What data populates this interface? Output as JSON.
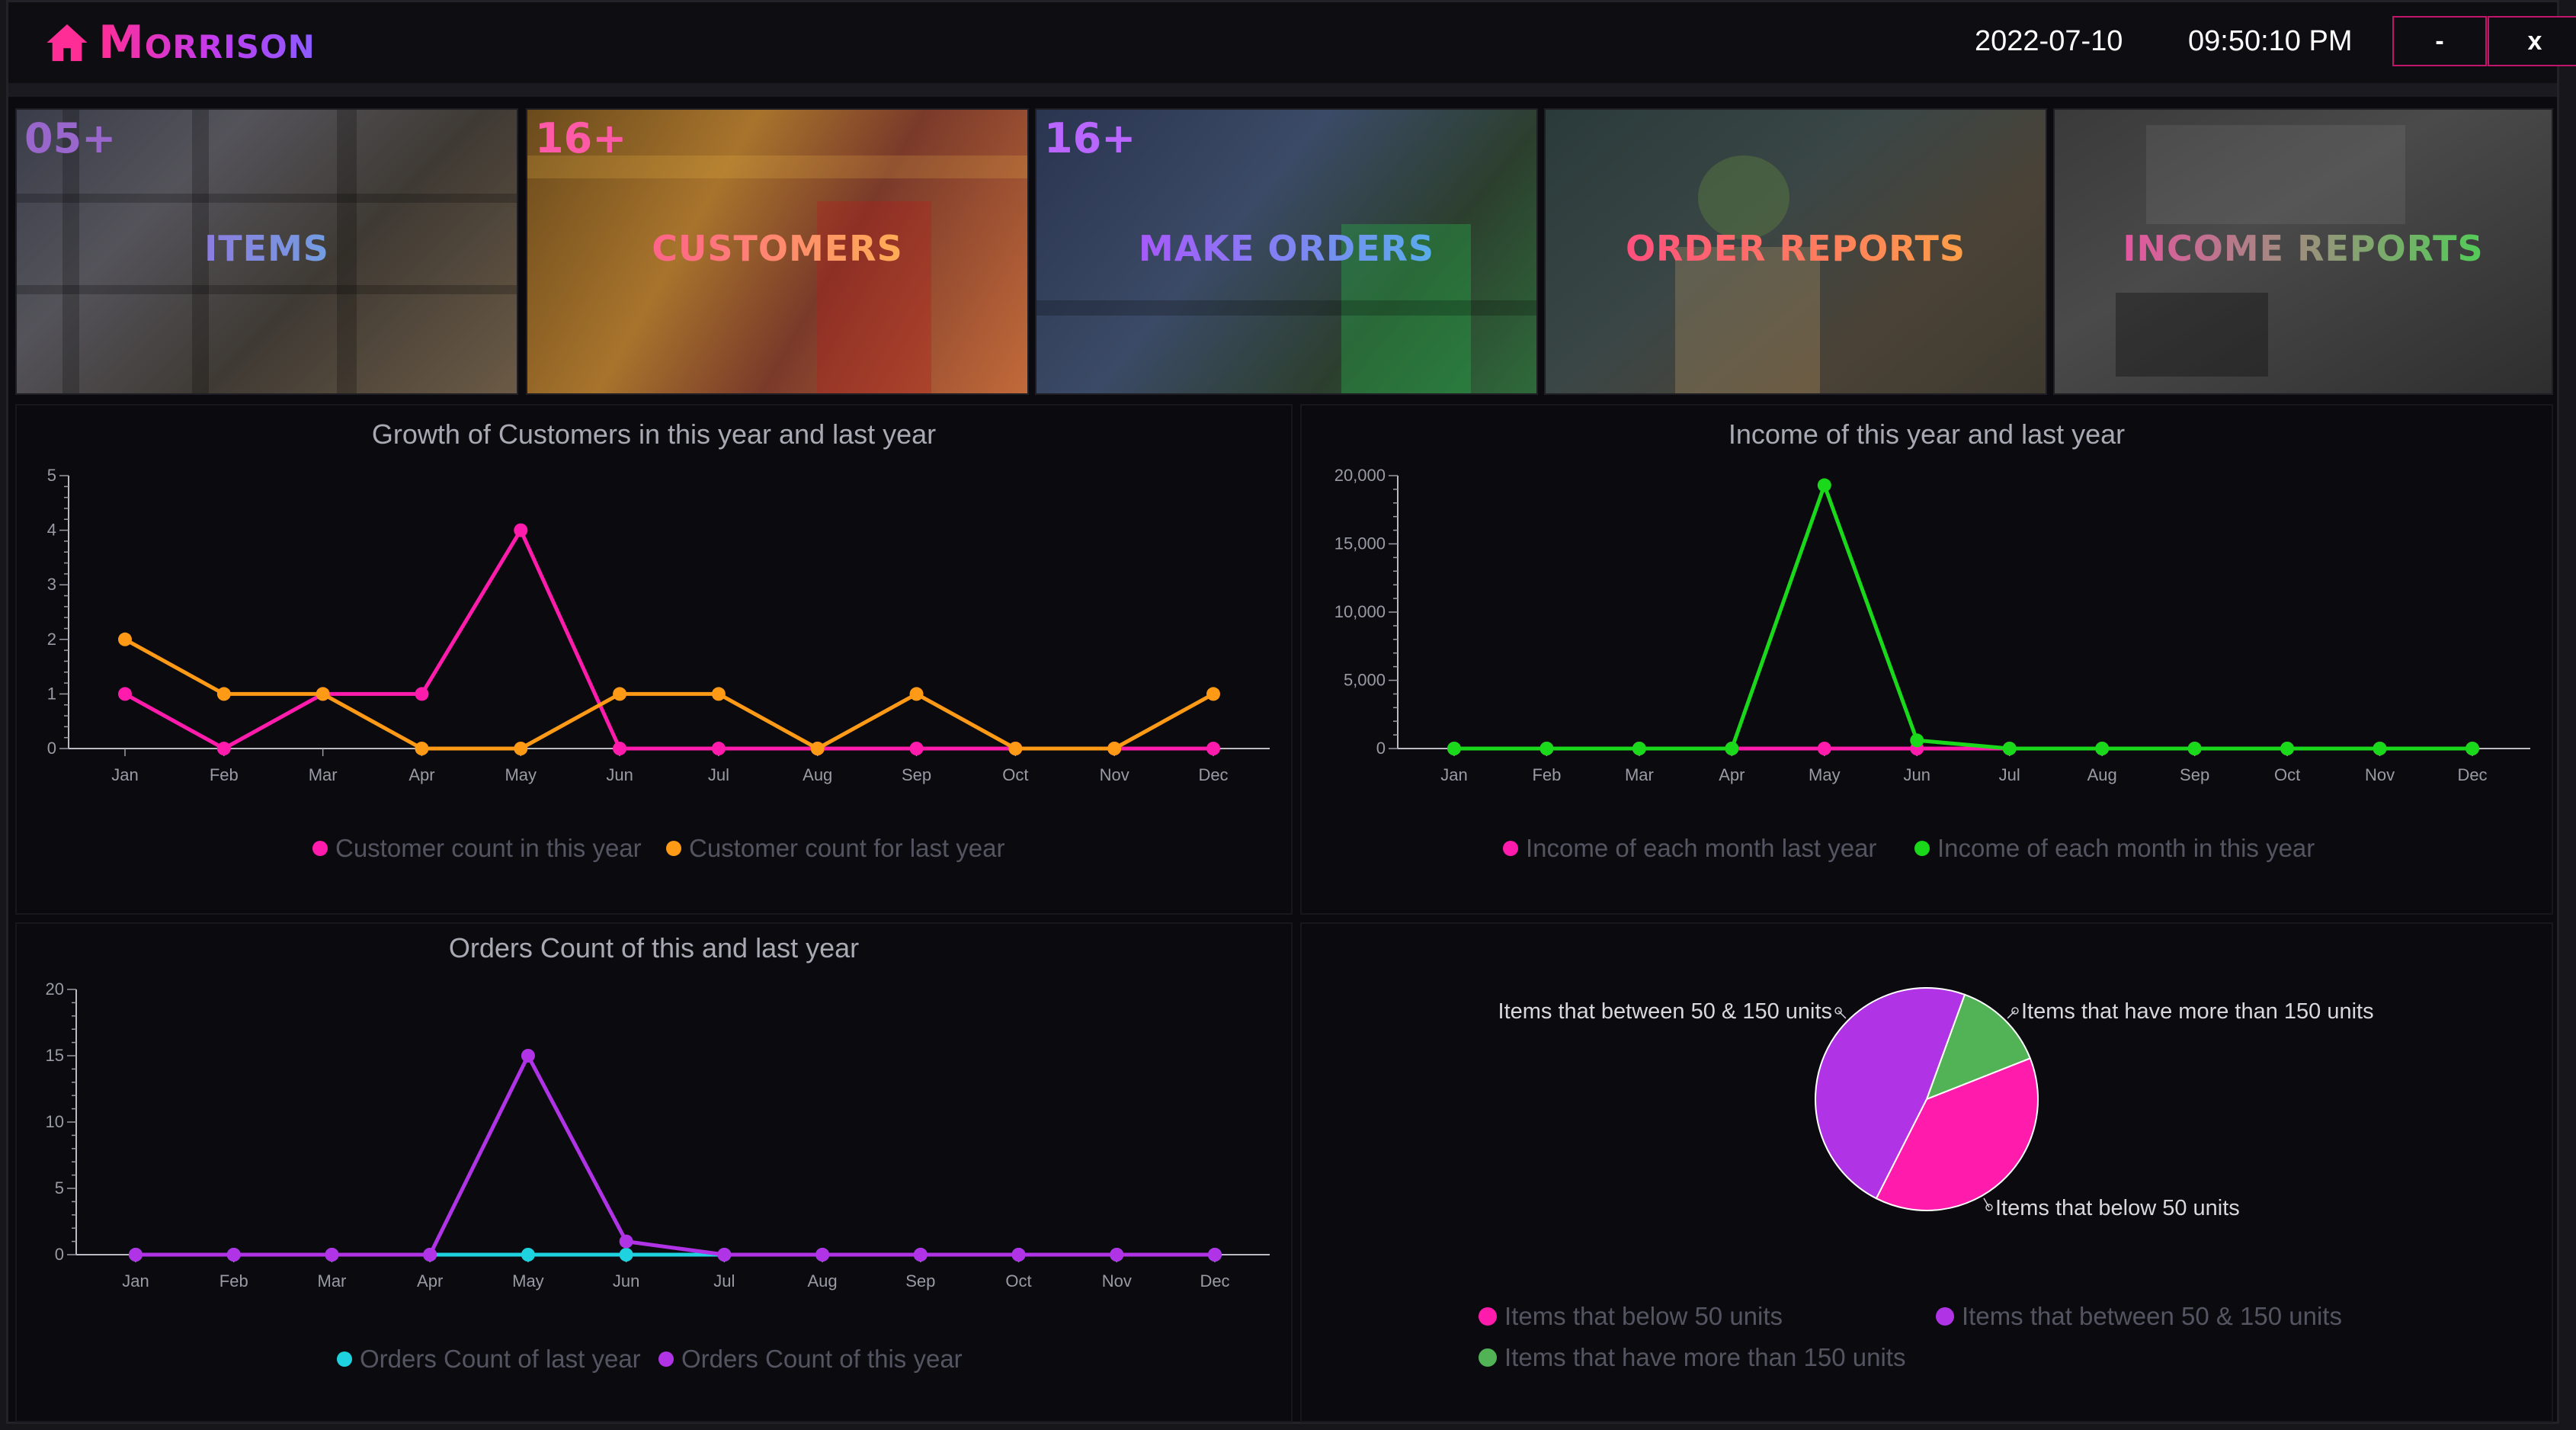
{
  "app": {
    "name": "Morrison",
    "date": "2022-07-10",
    "time": "09:50:10 PM",
    "minimize_label": "-",
    "close_label": "x"
  },
  "tiles": [
    {
      "label": "ITEMS",
      "count": "05+",
      "icon": "warehouse-photo"
    },
    {
      "label": "CUSTOMERS",
      "count": "16+",
      "icon": "store-customers-photo"
    },
    {
      "label": "MAKE ORDERS",
      "count": "16+",
      "icon": "cashier-photo"
    },
    {
      "label": "ORDER REPORTS",
      "count": "",
      "icon": "grocery-bag-photo"
    },
    {
      "label": "INCOME REPORTS",
      "count": "",
      "icon": "calculator-photo"
    }
  ],
  "colors": {
    "pink": "#ff1cac",
    "orange": "#ff9a16",
    "green": "#1ad81a",
    "purple": "#b133e6",
    "cyan": "#1fd2e0",
    "pie_green": "#52b356"
  },
  "chart_data": [
    {
      "type": "line",
      "title": "Growth of Customers in this year and last year",
      "x": [
        "Jan",
        "Feb",
        "Mar",
        "Apr",
        "May",
        "Jun",
        "Jul",
        "Aug",
        "Sep",
        "Oct",
        "Nov",
        "Dec"
      ],
      "ylim": [
        0,
        5
      ],
      "yticks": [
        "0",
        "1",
        "2",
        "3",
        "4",
        "5"
      ],
      "series": [
        {
          "name": "Customer count in this year",
          "color": "#ff1cac",
          "values": [
            1,
            0,
            1,
            1,
            4,
            0,
            0,
            0,
            0,
            0,
            0,
            0
          ]
        },
        {
          "name": "Customer count for last year",
          "color": "#ff9a16",
          "values": [
            2,
            1,
            1,
            0,
            0,
            1,
            1,
            0,
            1,
            0,
            0,
            1
          ]
        }
      ],
      "legend": "bottom"
    },
    {
      "type": "line",
      "title": "Income of this year and last year",
      "x": [
        "Jan",
        "Feb",
        "Mar",
        "Apr",
        "May",
        "Jun",
        "Jul",
        "Aug",
        "Sep",
        "Oct",
        "Nov",
        "Dec"
      ],
      "ylim": [
        0,
        20000
      ],
      "yticks": [
        "0",
        "5,000",
        "10,000",
        "15,000",
        "20,000"
      ],
      "series": [
        {
          "name": "Income of each month last year",
          "color": "#ff1cac",
          "values": [
            0,
            0,
            0,
            0,
            0,
            0,
            0,
            0,
            0,
            0,
            0,
            0
          ]
        },
        {
          "name": "Income of each month in this year",
          "color": "#1ad81a",
          "values": [
            0,
            0,
            0,
            0,
            19300,
            600,
            0,
            0,
            0,
            0,
            0,
            0
          ]
        }
      ],
      "legend": "bottom"
    },
    {
      "type": "line",
      "title": "Orders Count of this and last year",
      "x": [
        "Jan",
        "Feb",
        "Mar",
        "Apr",
        "May",
        "Jun",
        "Jul",
        "Aug",
        "Sep",
        "Oct",
        "Nov",
        "Dec"
      ],
      "ylim": [
        0,
        20
      ],
      "yticks": [
        "0",
        "5",
        "10",
        "15",
        "20"
      ],
      "series": [
        {
          "name": "Orders Count of last year",
          "color": "#1fd2e0",
          "values": [
            0,
            0,
            0,
            0,
            0,
            0,
            0,
            0,
            0,
            0,
            0,
            0
          ]
        },
        {
          "name": "Orders Count of this year",
          "color": "#b133e6",
          "values": [
            0,
            0,
            0,
            0,
            15,
            1,
            0,
            0,
            0,
            0,
            0,
            0
          ]
        }
      ],
      "legend": "bottom"
    },
    {
      "type": "pie",
      "slices": [
        {
          "label": "Items that below 50 units",
          "value": 2,
          "color": "#ff1cac"
        },
        {
          "label": "Items that between 50 & 150 units",
          "value": 2.5,
          "color": "#b133e6"
        },
        {
          "label": "Items that have more than 150 units",
          "value": 0.7,
          "color": "#52b356"
        }
      ],
      "legend": "bottom"
    }
  ]
}
